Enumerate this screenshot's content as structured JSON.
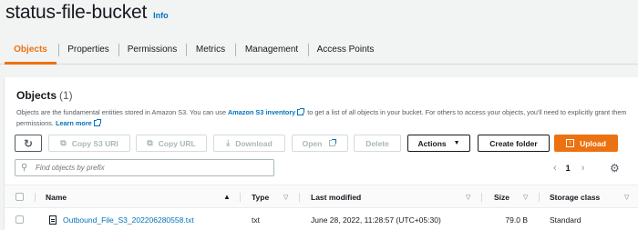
{
  "header": {
    "bucket_name": "status-file-bucket",
    "info_label": "Info"
  },
  "tabs": [
    {
      "label": "Objects",
      "active": true
    },
    {
      "label": "Properties"
    },
    {
      "label": "Permissions"
    },
    {
      "label": "Metrics"
    },
    {
      "label": "Management"
    },
    {
      "label": "Access Points"
    }
  ],
  "objects_panel": {
    "title": "Objects",
    "count": "(1)",
    "description": {
      "part1": "Objects are the fundamental entities stored in Amazon S3. You can use ",
      "inventory_link": "Amazon S3 inventory",
      "part2": " to get a list of all objects in your bucket. For others to access your objects, you'll need to explicitly grant them permissions. ",
      "learn_more": "Learn more"
    }
  },
  "toolbar": {
    "refresh_icon": "refresh-icon",
    "copy_s3_uri": "Copy S3 URI",
    "copy_url": "Copy URL",
    "download": "Download",
    "open": "Open",
    "delete": "Delete",
    "actions": "Actions",
    "create_folder": "Create folder",
    "upload": "Upload"
  },
  "search": {
    "placeholder": "Find objects by prefix"
  },
  "pagination": {
    "current_page": "1"
  },
  "table": {
    "columns": {
      "name": "Name",
      "type": "Type",
      "last_modified": "Last modified",
      "size": "Size",
      "storage_class": "Storage class"
    },
    "rows": [
      {
        "name": "Outbound_File_S3_202206280558.txt",
        "type": "txt",
        "last_modified": "June 28, 2022, 11:28:57 (UTC+05:30)",
        "size": "79.0 B",
        "storage_class": "Standard"
      }
    ]
  },
  "colors": {
    "accent": "#ec7211",
    "link": "#0073bb",
    "text": "#16191f",
    "muted": "#545b64"
  }
}
